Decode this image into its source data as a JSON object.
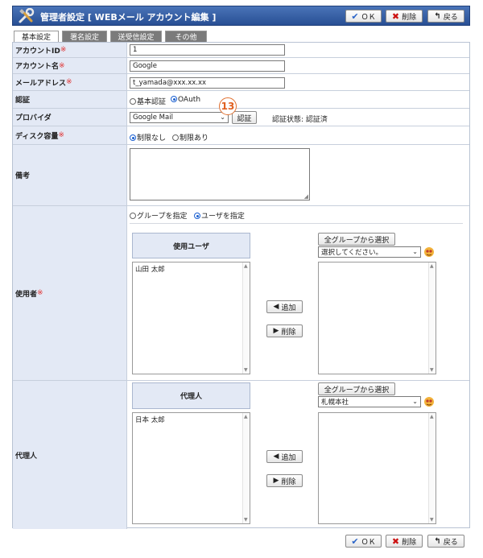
{
  "header": {
    "title": "管理者設定 [ WEBメール  アカウント編集 ]",
    "ok_label": "ＯＫ",
    "delete_label": "削除",
    "back_label": "戻る"
  },
  "tabs": [
    {
      "label": "基本設定",
      "active": true
    },
    {
      "label": "署名設定",
      "active": false
    },
    {
      "label": "送受信設定",
      "active": false
    },
    {
      "label": "その他",
      "active": false
    }
  ],
  "form": {
    "account_id": {
      "label": "アカウントID",
      "required": "※",
      "value": "1"
    },
    "account_name": {
      "label": "アカウント名",
      "required": "※",
      "value": "Google"
    },
    "mail_address": {
      "label": "メールアドレス",
      "required": "※",
      "value": "t_yamada@xxx.xx.xx"
    },
    "auth": {
      "label": "認証",
      "options": [
        "基本認証",
        "OAuth"
      ],
      "selected": "OAuth"
    },
    "provider": {
      "label": "プロバイダ",
      "value": "Google Mail",
      "auth_button": "認証",
      "status_text": "認証状態: 認証済",
      "callout_number": "13"
    },
    "disk": {
      "label": "ディスク容量",
      "required": "※",
      "options": [
        "制限なし",
        "制限あり"
      ],
      "selected": "制限なし"
    },
    "remarks": {
      "label": "備考"
    },
    "users": {
      "label": "使用者",
      "required": "※",
      "options": [
        "グループを指定",
        "ユーザを指定"
      ],
      "selected": "ユーザを指定",
      "list_header": "使用ユーザ",
      "selected_items": [
        "山田 太郎"
      ],
      "add_label": "追加",
      "remove_label": "削除",
      "all_groups_button": "全グループから選択",
      "group_select_value": "選択してください。"
    },
    "delegate": {
      "label": "代理人",
      "list_header": "代理人",
      "selected_items": [
        "日本 太郎"
      ],
      "add_label": "追加",
      "remove_label": "削除",
      "all_groups_button": "全グループから選択",
      "group_select_value": "札幌本社"
    }
  },
  "footer": {
    "ok_label": "ＯＫ",
    "delete_label": "削除",
    "back_label": "戻る"
  },
  "colors": {
    "header": "#284f94",
    "label_bg": "#e3e9f5",
    "required": "#e03030",
    "radio": "#1a5fd0"
  }
}
